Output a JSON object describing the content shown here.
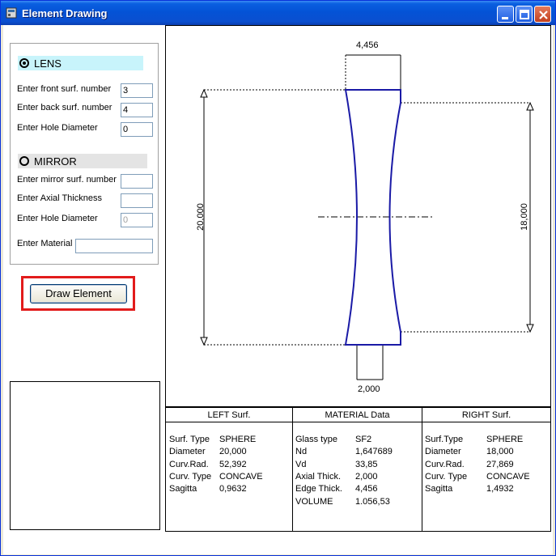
{
  "window": {
    "title": "Element Drawing"
  },
  "lens": {
    "label": "LENS",
    "front_label": "Enter front surf. number",
    "front_value": "3",
    "back_label": "Enter back surf. number",
    "back_value": "4",
    "hole_label": "Enter Hole Diameter",
    "hole_value": "0"
  },
  "mirror": {
    "label": "MIRROR",
    "surf_label": "Enter mirror surf. number",
    "surf_value": "",
    "axial_label": "Enter  Axial Thickness",
    "axial_value": "",
    "hole_label": "Enter  Hole Diameter",
    "hole_value": "0",
    "material_label": "Enter Material",
    "material_value": ""
  },
  "draw_button": "Draw Element",
  "drawing": {
    "edge_thickness": "4,456",
    "center_thickness": "2,000",
    "left_diameter": "20,000",
    "right_diameter": "18,000",
    "line_color": "#1a1aa6"
  },
  "left_surf": {
    "header": "LEFT  Surf.",
    "rows": [
      {
        "k": "Surf. Type",
        "v": "SPHERE"
      },
      {
        "k": "Diameter",
        "v": "20,000"
      },
      {
        "k": "Curv.Rad.",
        "v": "52,392"
      },
      {
        "k": "Curv. Type",
        "v": "CONCAVE"
      },
      {
        "k": "Sagitta",
        "v": "0,9632"
      }
    ]
  },
  "material": {
    "header": "MATERIAL  Data",
    "rows": [
      {
        "k": "Glass type",
        "v": "SF2"
      },
      {
        "k": "Nd",
        "v": "1,647689"
      },
      {
        "k": "Vd",
        "v": "33,85"
      },
      {
        "k": "Axial Thick.",
        "v": "2,000"
      },
      {
        "k": "Edge Thick.",
        "v": "4,456"
      },
      {
        "k": "VOLUME",
        "v": "1.056,53"
      }
    ]
  },
  "right_surf": {
    "header": "RIGHT  Surf.",
    "rows": [
      {
        "k": "Surf.Type",
        "v": "SPHERE"
      },
      {
        "k": "Diameter",
        "v": "18,000"
      },
      {
        "k": "Curv.Rad.",
        "v": "27,869"
      },
      {
        "k": "Curv. Type",
        "v": "CONCAVE"
      },
      {
        "k": "Sagitta",
        "v": "1,4932"
      }
    ]
  }
}
